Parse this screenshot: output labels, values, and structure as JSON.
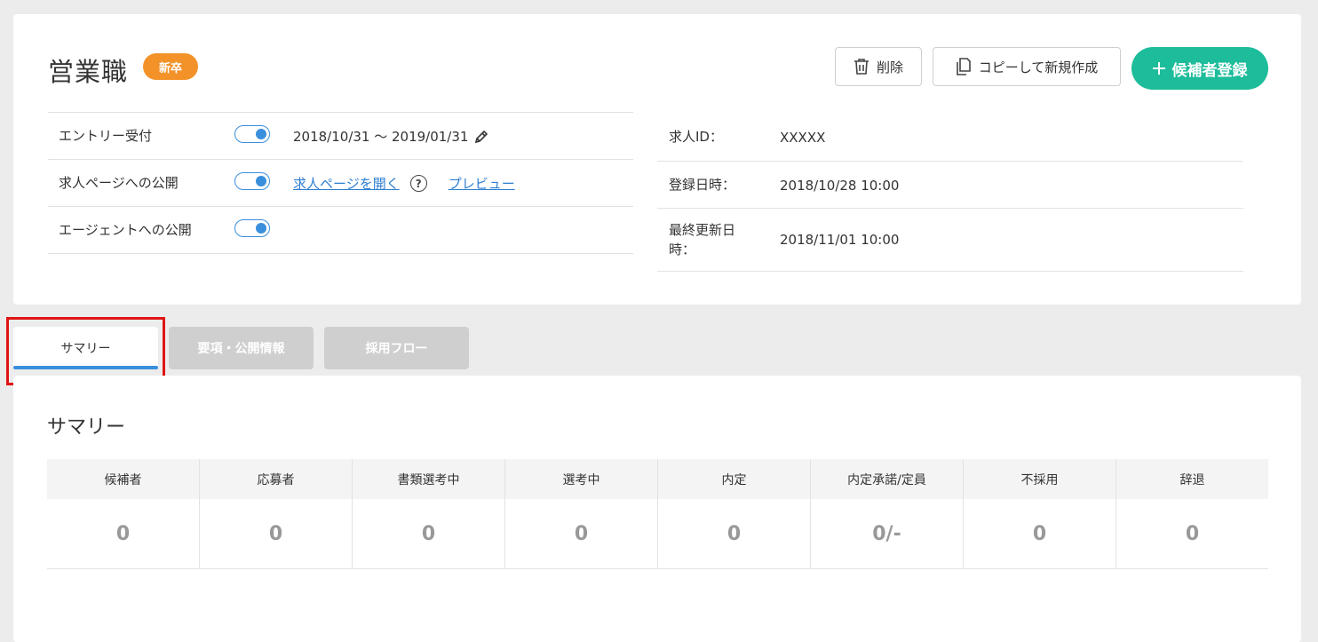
{
  "header": {
    "title": "営業職",
    "badge": "新卒",
    "delete_label": "削除",
    "copy_label": "コピーして新規作成",
    "add_label": "候補者登録"
  },
  "settings": {
    "entry_label": "エントリー受付",
    "entry_period": "2018/10/31 〜 2019/01/31",
    "job_page_label": "求人ページへの公開",
    "open_job_page_link": "求人ページを開く",
    "preview_link": "プレビュー",
    "agent_label": "エージェントへの公開"
  },
  "info": {
    "job_id_label": "求人ID：",
    "job_id_value": "XXXXX",
    "registered_label": "登録日時：",
    "registered_value": "2018/10/28 10:00",
    "updated_label_line1": "最終更新日",
    "updated_label_line2": "時：",
    "updated_value": "2018/11/01 10:00"
  },
  "tabs": {
    "summary": "サマリー",
    "info": "要項・公開情報",
    "flow": "採用フロー"
  },
  "summary": {
    "title": "サマリー",
    "columns": [
      {
        "head": "候補者",
        "value": "0"
      },
      {
        "head": "応募者",
        "value": "0"
      },
      {
        "head": "書類選考中",
        "value": "0"
      },
      {
        "head": "選考中",
        "value": "0"
      },
      {
        "head": "内定",
        "value": "0"
      },
      {
        "head": "内定承諾/定員",
        "value": "0/-"
      },
      {
        "head": "不採用",
        "value": "0"
      },
      {
        "head": "辞退",
        "value": "0"
      }
    ]
  },
  "colors": {
    "accent_green": "#1dbc9a",
    "badge_orange": "#f39229",
    "toggle_blue": "#3a8fdc",
    "highlight_red": "#e01414"
  }
}
